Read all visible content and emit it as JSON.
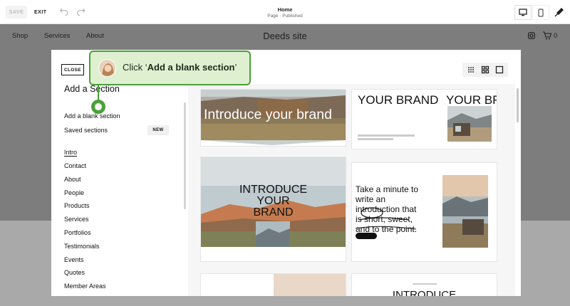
{
  "topbar": {
    "save_label": "SAVE",
    "exit_label": "EXIT",
    "page_title": "Home",
    "page_status": "Page · Published",
    "undo_icon": "undo-icon",
    "redo_icon": "redo-icon",
    "desktop_icon": "desktop-icon",
    "mobile_icon": "mobile-icon",
    "design_icon": "brush-icon"
  },
  "site": {
    "nav": [
      "Shop",
      "Services",
      "About"
    ],
    "title": "Deeds site",
    "cart_count": "0"
  },
  "modal": {
    "close_label": "CLOSE",
    "title": "Add a Section",
    "blank_section": "Add a blank section",
    "saved_sections": "Saved sections",
    "new_badge": "NEW",
    "categories": [
      "Intro",
      "Contact",
      "About",
      "People",
      "Products",
      "Services",
      "Portfolios",
      "Testimonials",
      "Events",
      "Quotes",
      "Member Areas"
    ],
    "active_category": "Intro",
    "view_icons": [
      "grid-small-icon",
      "grid-large-icon",
      "single-view-icon"
    ]
  },
  "templates": {
    "t1": "Introduce your brand",
    "t2a": "YOUR BRAND",
    "t2b": "YOUR BR",
    "t3a": "INTRODUCE",
    "t3b": "YOUR",
    "t3c": "BRAND",
    "t4": [
      "Take a minute to",
      "write an",
      "introduction that",
      "is short, sweet,",
      "and to the point."
    ],
    "t6": "INTRODUCE"
  },
  "callout": {
    "prefix": "Click ‘",
    "bold": "Add a blank section",
    "suffix": "’"
  },
  "colors": {
    "accent": "#4aa03a",
    "callout_bg": "#dff0d1"
  }
}
